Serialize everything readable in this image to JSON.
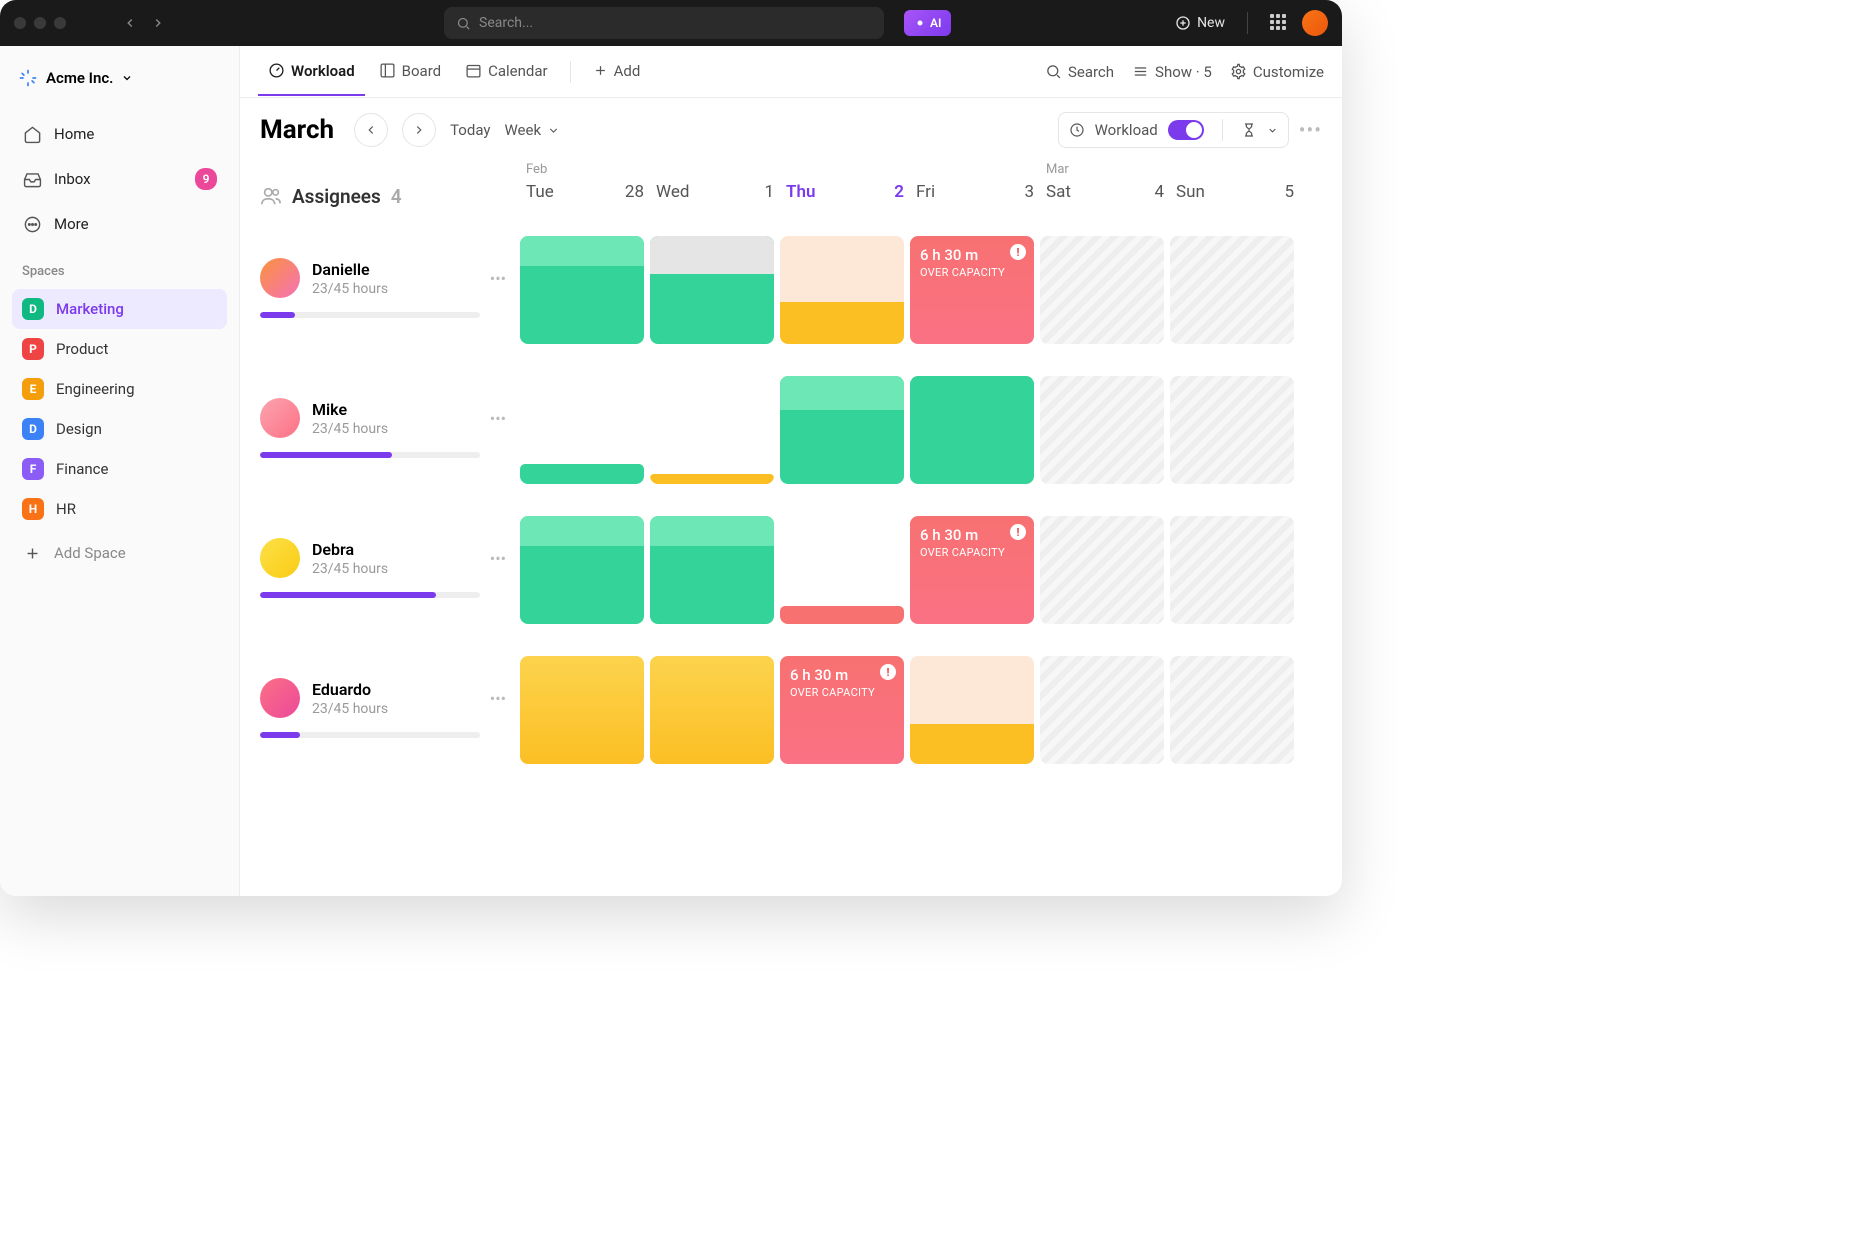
{
  "titlebar": {
    "search_placeholder": "Search...",
    "ai_label": "AI",
    "new_label": "New"
  },
  "workspace": {
    "name": "Acme Inc."
  },
  "sidebar": {
    "nav": [
      {
        "label": "Home"
      },
      {
        "label": "Inbox",
        "badge": "9"
      },
      {
        "label": "More"
      }
    ],
    "spaces_label": "Spaces",
    "spaces": [
      {
        "letter": "D",
        "label": "Marketing",
        "color": "#10b981",
        "active": true
      },
      {
        "letter": "P",
        "label": "Product",
        "color": "#ef4444"
      },
      {
        "letter": "E",
        "label": "Engineering",
        "color": "#f59e0b"
      },
      {
        "letter": "D",
        "label": "Design",
        "color": "#3b82f6"
      },
      {
        "letter": "F",
        "label": "Finance",
        "color": "#8b5cf6"
      },
      {
        "letter": "H",
        "label": "HR",
        "color": "#f97316"
      }
    ],
    "add_space": "Add Space"
  },
  "views": {
    "tabs": [
      {
        "label": "Workload",
        "active": true
      },
      {
        "label": "Board"
      },
      {
        "label": "Calendar"
      }
    ],
    "add": "Add",
    "search": "Search",
    "show": "Show · 5",
    "customize": "Customize"
  },
  "toolbar": {
    "month": "March",
    "today": "Today",
    "range": "Week",
    "workload_label": "Workload"
  },
  "grid": {
    "assignees_label": "Assignees",
    "assignees_count": "4",
    "days": [
      {
        "month": "Feb",
        "name": "Tue",
        "num": "28"
      },
      {
        "month": "",
        "name": "Wed",
        "num": "1"
      },
      {
        "month": "",
        "name": "Thu",
        "num": "2",
        "current": true
      },
      {
        "month": "",
        "name": "Fri",
        "num": "3"
      },
      {
        "month": "Mar",
        "name": "Sat",
        "num": "4"
      },
      {
        "month": "",
        "name": "Sun",
        "num": "5"
      }
    ],
    "people": [
      {
        "name": "Danielle",
        "hours": "23/45 hours",
        "progress": 16,
        "cells": [
          "teal-light-top",
          "teal-gray-top",
          "orange-bottom",
          "over",
          "hatch",
          "hatch"
        ]
      },
      {
        "name": "Mike",
        "hours": "23/45 hours",
        "progress": 60,
        "cells": [
          "teal-short",
          "orange-thin",
          "teal-mid",
          "teal-full",
          "hatch",
          "hatch"
        ]
      },
      {
        "name": "Debra",
        "hours": "23/45 hours",
        "progress": 80,
        "cells": [
          "teal-light-top",
          "teal-light-top",
          "red-short",
          "over",
          "hatch",
          "hatch"
        ]
      },
      {
        "name": "Eduardo",
        "hours": "23/45 hours",
        "progress": 18,
        "cells": [
          "orange-full",
          "orange-full",
          "over",
          "orange-short",
          "hatch",
          "hatch"
        ]
      }
    ],
    "over_text": {
      "t1": "6 h 30 m",
      "t2": "OVER CAPACITY"
    }
  }
}
